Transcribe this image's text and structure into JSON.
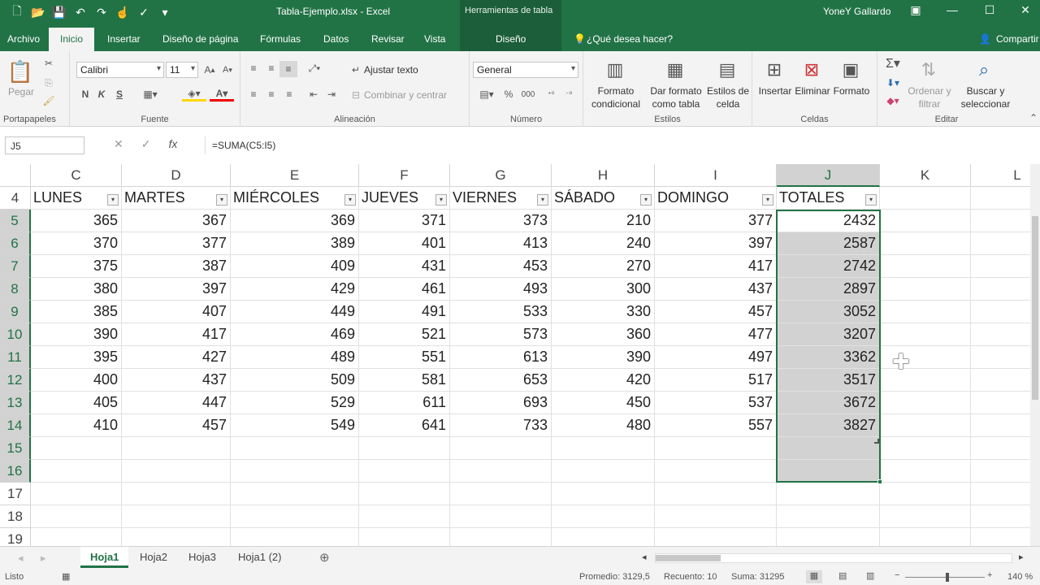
{
  "titlebar": {
    "qat_icons": [
      "new-file-icon",
      "open-folder-icon",
      "save-icon",
      "undo-icon",
      "redo-icon",
      "touch-mode-icon",
      "spellcheck-icon",
      "customize-qat-icon"
    ],
    "title": "Tabla-Ejemplo.xlsx  -  Excel",
    "tool_tab": "Herramientas de tabla",
    "user": "YoneY Gallardo"
  },
  "tabs": [
    "Archivo",
    "Inicio",
    "Insertar",
    "Diseño de página",
    "Fórmulas",
    "Datos",
    "Revisar",
    "Vista",
    "Diseño"
  ],
  "tell_me": "¿Qué desea hacer?",
  "share": "Compartir",
  "ribbon": {
    "portapapeles": {
      "label": "Portapapeles",
      "paste": "Pegar"
    },
    "fuente": {
      "label": "Fuente",
      "font": "Calibri",
      "size": "11",
      "bold": "N",
      "italic": "K",
      "underline": "S"
    },
    "alineacion": {
      "label": "Alineación",
      "wrap": "Ajustar texto",
      "merge": "Combinar y centrar"
    },
    "numero": {
      "label": "Número",
      "format": "General",
      "percent": "%",
      "thousands": "000"
    },
    "estilos": {
      "label": "Estilos",
      "cond": "Formato condicional",
      "table": "Dar formato como tabla",
      "cell": "Estilos de celda"
    },
    "celdas": {
      "label": "Celdas",
      "insert": "Insertar",
      "delete": "Eliminar",
      "format": "Formato"
    },
    "editar": {
      "label": "Editar",
      "sort": "Ordenar y filtrar",
      "find": "Buscar y seleccionar"
    }
  },
  "formula": {
    "namebox": "J5",
    "fx": "fx",
    "value": "=SUMA(C5:I5)"
  },
  "columns": [
    "C",
    "D",
    "E",
    "F",
    "G",
    "H",
    "I",
    "J",
    "K",
    "L"
  ],
  "headers": [
    "LUNES",
    "MARTES",
    "MIÉRCOLES",
    "JUEVES",
    "VIERNES",
    "SÁBADO",
    "DOMINGO",
    "TOTALES"
  ],
  "rows": [
    {
      "n": "4"
    },
    {
      "n": "5",
      "v": [
        "365",
        "367",
        "369",
        "371",
        "373",
        "210",
        "377",
        "2432"
      ]
    },
    {
      "n": "6",
      "v": [
        "370",
        "377",
        "389",
        "401",
        "413",
        "240",
        "397",
        "2587"
      ]
    },
    {
      "n": "7",
      "v": [
        "375",
        "387",
        "409",
        "431",
        "453",
        "270",
        "417",
        "2742"
      ]
    },
    {
      "n": "8",
      "v": [
        "380",
        "397",
        "429",
        "461",
        "493",
        "300",
        "437",
        "2897"
      ]
    },
    {
      "n": "9",
      "v": [
        "385",
        "407",
        "449",
        "491",
        "533",
        "330",
        "457",
        "3052"
      ]
    },
    {
      "n": "10",
      "v": [
        "390",
        "417",
        "469",
        "521",
        "573",
        "360",
        "477",
        "3207"
      ]
    },
    {
      "n": "11",
      "v": [
        "395",
        "427",
        "489",
        "551",
        "613",
        "390",
        "497",
        "3362"
      ]
    },
    {
      "n": "12",
      "v": [
        "400",
        "437",
        "509",
        "581",
        "653",
        "420",
        "517",
        "3517"
      ]
    },
    {
      "n": "13",
      "v": [
        "405",
        "447",
        "529",
        "611",
        "693",
        "450",
        "537",
        "3672"
      ]
    },
    {
      "n": "14",
      "v": [
        "410",
        "457",
        "549",
        "641",
        "733",
        "480",
        "557",
        "3827"
      ]
    },
    {
      "n": "15"
    },
    {
      "n": "16"
    },
    {
      "n": "17"
    },
    {
      "n": "18"
    },
    {
      "n": "19"
    }
  ],
  "sheets": [
    "Hoja1",
    "Hoja2",
    "Hoja3",
    "Hoja1 (2)"
  ],
  "status": {
    "mode": "Listo",
    "avg": "Promedio: 3129,5",
    "count": "Recuento: 10",
    "sum": "Suma: 31295",
    "zoom": "140 %"
  },
  "colors": {
    "accent": "#217346",
    "selection": "#d2d2d2"
  }
}
